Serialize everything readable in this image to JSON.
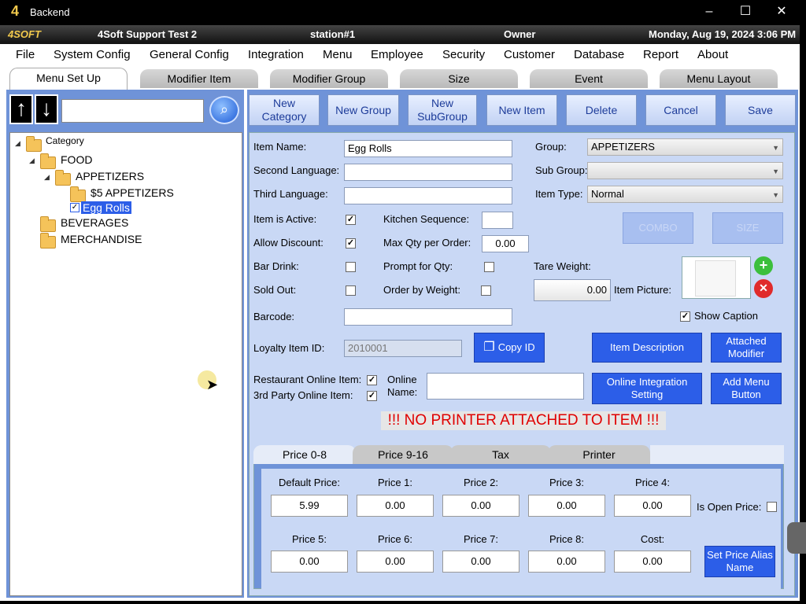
{
  "window": {
    "title": "Backend",
    "logo_text": "4"
  },
  "status": {
    "brand": "4SOFT",
    "store": "4Soft Support Test 2",
    "station": "station#1",
    "user": "Owner",
    "datetime": "Monday, Aug 19, 2024 3:06 PM"
  },
  "menu": [
    "File",
    "System Config",
    "General Config",
    "Integration",
    "Menu",
    "Employee",
    "Security",
    "Customer",
    "Database",
    "Report",
    "About"
  ],
  "tabs": [
    "Menu Set Up",
    "Modifier Item",
    "Modifier Group",
    "Size",
    "Event",
    "Menu Layout"
  ],
  "toolbar": {
    "new_category": "New Category",
    "new_group": "New Group",
    "new_subgroup": "New SubGroup",
    "new_item": "New Item",
    "delete": "Delete",
    "cancel": "Cancel",
    "save": "Save"
  },
  "tree": {
    "root": "Category",
    "food": "FOOD",
    "appetizers": "APPETIZERS",
    "five_appetizers": "$5 APPETIZERS",
    "egg_rolls": "Egg Rolls",
    "beverages": "BEVERAGES",
    "merchandise": "MERCHANDISE"
  },
  "form": {
    "item_name_label": "Item Name:",
    "item_name": "Egg Rolls",
    "second_language_label": "Second Language:",
    "third_language_label": "Third Language:",
    "group_label": "Group:",
    "group": "APPETIZERS",
    "sub_group_label": "Sub Group:",
    "sub_group": "",
    "item_type_label": "Item Type:",
    "item_type": "Normal",
    "item_active_label": "Item is Active:",
    "kitchen_sequence_label": "Kitchen Sequence:",
    "allow_discount_label": "Allow Discount:",
    "max_qty_label": "Max Qty per Order:",
    "max_qty": "0.00",
    "bar_drink_label": "Bar Drink:",
    "prompt_qty_label": "Prompt for Qty:",
    "tare_weight_label": "Tare Weight:",
    "sold_out_label": "Sold Out:",
    "order_weight_label": "Order by Weight:",
    "tare_weight": "0.00",
    "item_picture_label": "Item Picture:",
    "show_caption_label": "Show Caption",
    "barcode_label": "Barcode:",
    "loyalty_label": "Loyalty Item ID:",
    "loyalty_id": "2010001",
    "restaurant_online_label": "Restaurant Online Item:",
    "third_party_online_label": "3rd Party Online Item:",
    "online_name_label": "Online Name:",
    "warning": "!!! NO PRINTER ATTACHED TO ITEM !!!"
  },
  "buttons": {
    "combo": "COMBO",
    "size": "SIZE",
    "copy_id": "Copy ID",
    "item_description": "Item Description",
    "attached_modifier": "Attached Modifier",
    "online_integration": "Online Integration Setting",
    "add_menu_button": "Add Menu Button",
    "set_price_alias": "Set Price Alias Name"
  },
  "price_tabs": [
    "Price 0-8",
    "Price 9-16",
    "Tax",
    "Printer"
  ],
  "prices": {
    "labels_row1": [
      "Default Price:",
      "Price 1:",
      "Price 2:",
      "Price 3:",
      "Price 4:"
    ],
    "values_row1": [
      "5.99",
      "0.00",
      "0.00",
      "0.00",
      "0.00"
    ],
    "labels_row2": [
      "Price 5:",
      "Price 6:",
      "Price 7:",
      "Price 8:",
      "Cost:"
    ],
    "values_row2": [
      "0.00",
      "0.00",
      "0.00",
      "0.00",
      "0.00"
    ],
    "open_price_label": "Is Open Price:"
  },
  "colors": {
    "panel_blue": "#6f93d8",
    "form_bg": "#c9d8f5",
    "button_blue": "#2c5ee8",
    "warning_red": "#e00000",
    "selection": "#2c5ee8"
  }
}
